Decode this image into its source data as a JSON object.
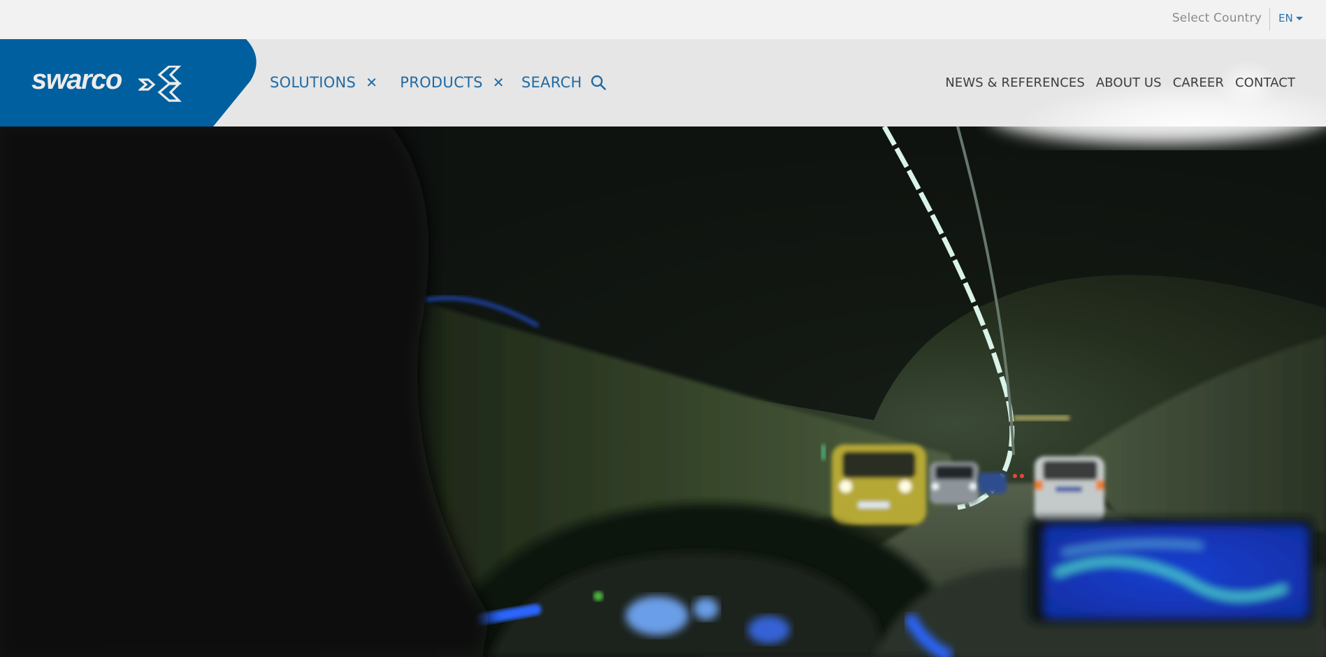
{
  "topbar": {
    "country_selector": "Select Country",
    "language": "EN"
  },
  "brand": {
    "name": "swarco",
    "color": "#005f9e"
  },
  "nav": {
    "primary": [
      {
        "label": "SOLUTIONS",
        "icon": "close-icon"
      },
      {
        "label": "PRODUCTS",
        "icon": "close-icon"
      },
      {
        "label": "SEARCH",
        "icon": "search-icon"
      }
    ],
    "secondary": [
      {
        "label": "NEWS & REFERENCES"
      },
      {
        "label": "ABOUT US"
      },
      {
        "label": "CAREER"
      },
      {
        "label": "CONTACT"
      }
    ]
  },
  "hero": {
    "image_description": "Driver's view inside a car driving through a lit road tunnel with traffic ahead",
    "colors": {
      "primary_text": "#1f6aa5",
      "secondary_text": "#3d3d3d",
      "muted_text": "#8a8a8a"
    }
  }
}
